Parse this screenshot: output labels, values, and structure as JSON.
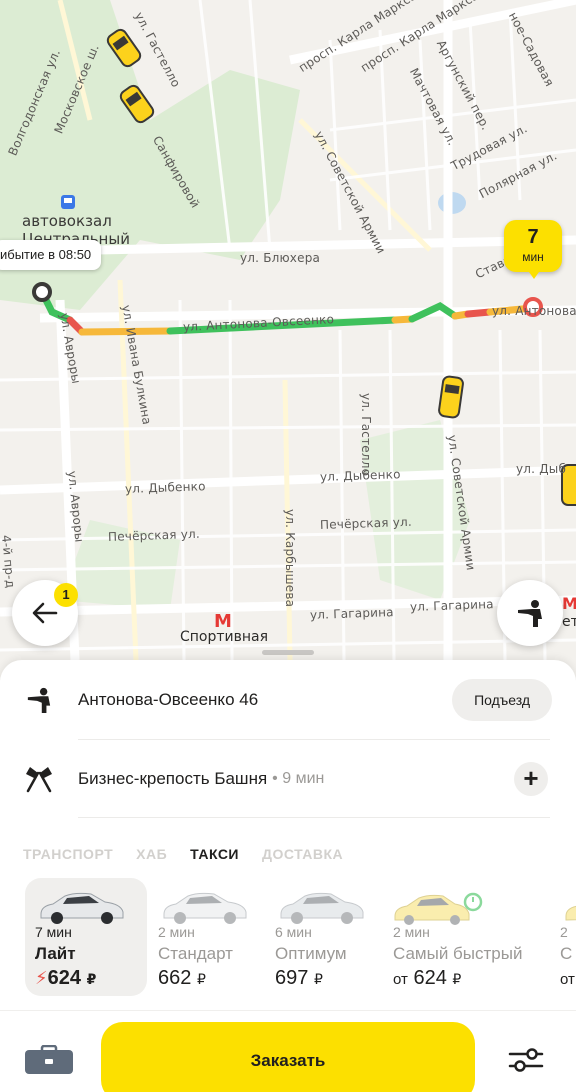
{
  "map": {
    "streets": [
      {
        "text": "ул. Гастелло"
      },
      {
        "text": "просп. Карла Маркса"
      },
      {
        "text": "просп. Карла Маркса"
      },
      {
        "text": "Аргунский пер."
      },
      {
        "text": "Мачтовая ул."
      },
      {
        "text": "Трудовая ул."
      },
      {
        "text": "Полярная ул."
      },
      {
        "text": "Волгодонская ул."
      },
      {
        "text": "Московское ш."
      },
      {
        "text": "Санфировой"
      },
      {
        "text": "ул. Советской Армии"
      },
      {
        "text": "ул. Блюхера"
      },
      {
        "text": "ул. Авроры"
      },
      {
        "text": "ул. Ивана Булкина"
      },
      {
        "text": "ул. Антонова-Овсеенко"
      },
      {
        "text": "ул. Антонова"
      },
      {
        "text": "ул. Гастелло"
      },
      {
        "text": "ул. Советской Армии"
      },
      {
        "text": "ул. Дыбенко"
      },
      {
        "text": "ул. Дыбенко"
      },
      {
        "text": "ул. Авроры"
      },
      {
        "text": "ул. Карбышева"
      },
      {
        "text": "Печёрская ул."
      },
      {
        "text": "Печёрская ул."
      },
      {
        "text": "ул. Гагарина"
      },
      {
        "text": "ул. Гагарина"
      },
      {
        "text": "4-й пр-д"
      },
      {
        "text": "Ставр"
      },
      {
        "text": "ул. Дыб"
      },
      {
        "text": "ное-Садовая"
      }
    ],
    "bus_station": "автовокзал Центральный",
    "metro_station": "Спортивная",
    "metro_station_partial": "ет",
    "arrival_chip": "ибытие в 08:50",
    "eta": {
      "value": "7",
      "unit": "мин"
    },
    "back_badge": "1"
  },
  "route": {
    "from": {
      "address": "Антонова-Овсеенко 46",
      "entrance_button": "Подъезд"
    },
    "to": {
      "name": "Бизнес-крепость Башня",
      "duration": "• 9 мин"
    }
  },
  "tabs": [
    {
      "label": "ТРАНСПОРТ",
      "active": false
    },
    {
      "label": "ХАБ",
      "active": false
    },
    {
      "label": "ТАКСИ",
      "active": true
    },
    {
      "label": "ДОСТАВКА",
      "active": false
    }
  ],
  "tariffs": [
    {
      "time": "7 мин",
      "name": "Лайт",
      "price_prefix": "",
      "price": "624",
      "currency": "₽",
      "selected": true,
      "surge": true
    },
    {
      "time": "2 мин",
      "name": "Стандарт",
      "price_prefix": "",
      "price": "662",
      "currency": "₽",
      "selected": false,
      "surge": false
    },
    {
      "time": "6 мин",
      "name": "Оптимум",
      "price_prefix": "",
      "price": "697",
      "currency": "₽",
      "selected": false,
      "surge": false
    },
    {
      "time": "2 мин",
      "name": "Самый быстрый",
      "price_prefix": "от",
      "price": "624",
      "currency": "₽",
      "selected": false,
      "surge": false
    },
    {
      "time": "2",
      "name": "С",
      "price_prefix": "от",
      "price": "",
      "currency": "",
      "selected": false,
      "surge": false
    }
  ],
  "bottom": {
    "order_label": "Заказать"
  },
  "colors": {
    "accent": "#fce000",
    "traffic_green": "#3fc15c",
    "traffic_yellow": "#f6b83a",
    "traffic_red": "#e8554d",
    "park": "#d9ecd2"
  }
}
